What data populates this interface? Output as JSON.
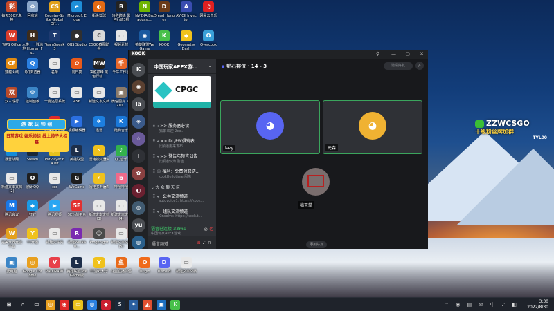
{
  "desktop": {
    "icons": [
      {
        "label": "每天500元兑换",
        "color": "#c94a2a",
        "glyph": "彩"
      },
      {
        "label": "回收站",
        "color": "#8aa6c9",
        "glyph": "♻"
      },
      {
        "label": "Counter-Strike Global Off...",
        "color": "#e1a11b",
        "glyph": "CS"
      },
      {
        "label": "Microsoft Edge",
        "color": "#1e8ed8",
        "glyph": "e"
      },
      {
        "label": "街头篮球",
        "color": "#e36a14",
        "glyph": "◐"
      },
      {
        "label": "决胜巅峰 黑色行动3机",
        "color": "#222",
        "glyph": "B"
      },
      {
        "label": "NVIDIA Broadcast...",
        "color": "#6fb400",
        "glyph": "N"
      },
      {
        "label": "Dread Hunger",
        "color": "#6b3b1a",
        "glyph": "D"
      },
      {
        "label": "AVICII Invector",
        "color": "#3a4db0",
        "glyph": "A"
      },
      {
        "label": "网易云音乐",
        "color": "#e02020",
        "glyph": "♫"
      },
      {
        "label": "WPS Office",
        "color": "#d83b2b",
        "glyph": "W"
      },
      {
        "label": "人类：一败涂地 Human Fa...",
        "color": "#3c2c1c",
        "glyph": "H"
      },
      {
        "label": "TeamSpeak 3",
        "color": "#1e3a70",
        "glyph": "T"
      },
      {
        "label": "OBS Studio",
        "color": "#303030",
        "glyph": "●"
      },
      {
        "label": "CSGO截图助手",
        "color": "#d9d9d9",
        "glyph": "C"
      },
      {
        "label": "视频素材",
        "color": "#e6e6e6",
        "glyph": "▭"
      },
      {
        "label": "英雄联盟WeGame",
        "color": "#1a5aa0",
        "glyph": "◉"
      },
      {
        "label": "KOOK",
        "color": "#48c04a",
        "glyph": "K"
      },
      {
        "label": "Geometry Dash",
        "color": "#f0c21c",
        "glyph": "◆"
      },
      {
        "label": "Overcook",
        "color": "#3aa0d9",
        "glyph": "O"
      },
      {
        "label": "穿越火线",
        "color": "#e08a12",
        "glyph": "CF"
      },
      {
        "label": "QQ浏览器",
        "color": "#2a7fe0",
        "glyph": "Q"
      },
      {
        "label": "名单",
        "color": "#e8e8e8",
        "glyph": "▭"
      },
      {
        "label": "向日葵",
        "color": "#e85a1a",
        "glyph": "✿"
      },
      {
        "label": "决胜巅峰 黑色行动...",
        "color": "#222",
        "glyph": "MW"
      },
      {
        "label": "千牛工作台",
        "color": "#e8682a",
        "glyph": "千"
      },
      {
        "label": "双人成行",
        "color": "#b84a2a",
        "glyph": "双"
      },
      {
        "label": "控制面板",
        "color": "#3b85c6",
        "glyph": "⚙"
      },
      {
        "label": "一键还原系统",
        "color": "#e8e8e8",
        "glyph": "▭"
      },
      {
        "label": "456",
        "color": "#e8e8e8",
        "glyph": "▭"
      },
      {
        "label": "新建文本文档",
        "color": "#e8e8e8",
        "glyph": "▭"
      },
      {
        "label": "微信图片 20210...",
        "color": "#8a7a6a",
        "glyph": "▣"
      },
      {
        "label": "极速PDF阅读器",
        "color": "#e02a2a",
        "glyph": "P"
      },
      {
        "label": "视频编辑器",
        "color": "#2b6fe0",
        "glyph": "▶"
      },
      {
        "label": "迅雷",
        "color": "#1d7fe0",
        "glyph": "✈"
      },
      {
        "label": "酷狗音乐",
        "color": "#1a78d9",
        "glyph": "K"
      },
      {
        "label": "暴雪战网",
        "color": "#148bd8",
        "glyph": "B"
      },
      {
        "label": "Steam",
        "color": "#1b2838",
        "glyph": "S"
      },
      {
        "label": "PotPlayer 64 bit",
        "color": "#e8c21c",
        "glyph": "▶"
      },
      {
        "label": "英雄联盟",
        "color": "#1e2f4a",
        "glyph": "L"
      },
      {
        "label": "雷电模拟器4",
        "color": "#f0c21c",
        "glyph": "⚡"
      },
      {
        "label": "QQ音乐",
        "color": "#33b24c",
        "glyph": "♪"
      },
      {
        "label": "新建文本文档 (2)",
        "color": "#e8e8e8",
        "glyph": "▭"
      },
      {
        "label": "腾讯QQ",
        "color": "#1f1f1f",
        "glyph": "Q"
      },
      {
        "label": "cor",
        "color": "#e8e8e8",
        "glyph": "▭"
      },
      {
        "label": "WeGame",
        "color": "#1d1d1d",
        "glyph": "G"
      },
      {
        "label": "雷电多开器4",
        "color": "#f0c21c",
        "glyph": "⚡"
      },
      {
        "label": "哔哩哔哩",
        "color": "#f06a8a",
        "glyph": "b"
      },
      {
        "label": "腾讯会议",
        "color": "#1a77e6",
        "glyph": "M"
      },
      {
        "label": "钉钉",
        "color": "#1a9ae6",
        "glyph": "◆"
      },
      {
        "label": "腾讯视频",
        "color": "#2aa6f2",
        "glyph": "▶"
      },
      {
        "label": "5E对战平台",
        "color": "#e23030",
        "glyph": "5E"
      },
      {
        "label": "新建文本文档 (3)",
        "color": "#e8e8e8",
        "glyph": "▭"
      },
      {
        "label": "新建文本文档 (4)",
        "color": "#e8e8e8",
        "glyph": "▭"
      },
      {
        "label": "完美世界竞技平台",
        "color": "#e5a11b",
        "glyph": "W"
      },
      {
        "label": "YY开播",
        "color": "#f0c21c",
        "glyph": "Y"
      },
      {
        "label": "新建文件夹",
        "color": "#e8e8e8",
        "glyph": "▭"
      },
      {
        "label": "新建WinRAR...",
        "color": "#7a2ab0",
        "glyph": "R"
      },
      {
        "label": "Progknight",
        "color": "#4a4a4a",
        "glyph": "☺"
      },
      {
        "label": "新建文本文档 (5)",
        "color": "#e8e8e8",
        "glyph": "▭"
      },
      {
        "label": "此电脑",
        "color": "#3b85c6",
        "glyph": "▣"
      },
      {
        "label": "Google Chrome",
        "color": "#e8a020",
        "glyph": "◎"
      },
      {
        "label": "VALORANT",
        "color": "#e8404a",
        "glyph": "V"
      },
      {
        "label": "英雄联盟 WeGame版",
        "color": "#1e2f4a",
        "glyph": "L"
      },
      {
        "label": "YY游戏大厅",
        "color": "#f0c21c",
        "glyph": "Y"
      },
      {
        "label": "斗鱼直播伴侣",
        "color": "#e86a1a",
        "glyph": "鱼"
      },
      {
        "label": "Origin",
        "color": "#f06a1a",
        "glyph": "O"
      },
      {
        "label": "Discord",
        "color": "#5865f2",
        "glyph": "D"
      },
      {
        "label": "新建文本文档",
        "color": "#e8e8e8",
        "glyph": "▭"
      }
    ],
    "promo_left": {
      "line1": "游 戏 玩 帅 组",
      "line2": "日常游戏 娱乐帅组 线上帅子大招募"
    },
    "promo_right": {
      "title": "ZZWCSGO",
      "subtitle": "十级粉丝牌加群",
      "tag": "TYL00"
    }
  },
  "app": {
    "logo": "KOOK",
    "window_controls": [
      "⚲",
      "—",
      "▢",
      "✕"
    ],
    "rail": [
      {
        "glyph": "K",
        "color": "#4a4d52"
      },
      {
        "glyph": "◉",
        "color": "#5b4030"
      },
      {
        "glyph": "la",
        "color": "#4a4d52"
      },
      {
        "glyph": "◈",
        "color": "#3a5a8a"
      },
      {
        "glyph": "☆",
        "color": "#6a5a9a"
      },
      {
        "glyph": "+",
        "color": "#2f3136"
      },
      {
        "glyph": "✿",
        "color": "#8a4040"
      },
      {
        "glyph": "◐",
        "color": "#6a2030"
      },
      {
        "glyph": "◎",
        "color": "#405a70"
      },
      {
        "glyph": "yu",
        "color": "#4a4d52"
      },
      {
        "glyph": "◍",
        "color": "#2a5f8a"
      }
    ],
    "server": {
      "name": "中国玩家APEX游...",
      "banner_title": "CPGC",
      "channels": [
        {
          "name": ">> 服务器必读",
          "desc": "加群 欢迎 2cp..."
        },
        {
          "name": ">> DL/PW俱销表",
          "desc": "此频道用来发布..."
        },
        {
          "name": ">> 警告与禁言公告",
          "desc": "此频道仅为 警告..."
        },
        {
          "name": "福利：免费领取游...",
          "desc": "kookHellotime 服务"
        }
      ],
      "category": "大 众 聊 天 区",
      "voice_channels": [
        {
          "name": "公共交流频道",
          "desc": "autovoice1: https://kook..."
        },
        {
          "name": "组队交流频道",
          "desc": "Kinsolve: https://kook.t..."
        }
      ],
      "voice_status": {
        "label": "语音已连接 33ms",
        "sub": "中国玩家APEX游戏..."
      },
      "user_name": "语音频道"
    },
    "main": {
      "channel_name": "钻石排位 · 14 - 3",
      "header_button": "邀请好友",
      "participants": [
        {
          "name": "lazy",
          "avatar_color": "#5865f2"
        },
        {
          "name": "元森",
          "avatar_color": "#f0b232"
        },
        {
          "name": "稿灭掌",
          "avatar_color": "#7a6e6e"
        }
      ],
      "bottom_pill": "添加好友"
    }
  },
  "taskbar": {
    "apps": [
      {
        "glyph": "⊞",
        "color": "transparent"
      },
      {
        "glyph": "⌕",
        "color": "transparent"
      },
      {
        "glyph": "▭",
        "color": "transparent"
      },
      {
        "glyph": "◎",
        "color": "#e8a020"
      },
      {
        "glyph": "◉",
        "color": "#e02a2a"
      },
      {
        "glyph": "▭",
        "color": "#e8c21c"
      },
      {
        "glyph": "◍",
        "color": "#2a7fe0"
      },
      {
        "glyph": "◆",
        "color": "#cc2030"
      },
      {
        "glyph": "S",
        "color": "#1b2838"
      },
      {
        "glyph": "✦",
        "color": "#2a5fa0"
      },
      {
        "glyph": "◭",
        "color": "#e05030"
      },
      {
        "glyph": "▣",
        "color": "#1d6fc0"
      },
      {
        "glyph": "K",
        "color": "#48c04a"
      }
    ],
    "tray_icons": "⌃ ◉ ▤ ✉ 中 ♪ ◧",
    "time": "3:30",
    "date": "2022/8/30"
  }
}
